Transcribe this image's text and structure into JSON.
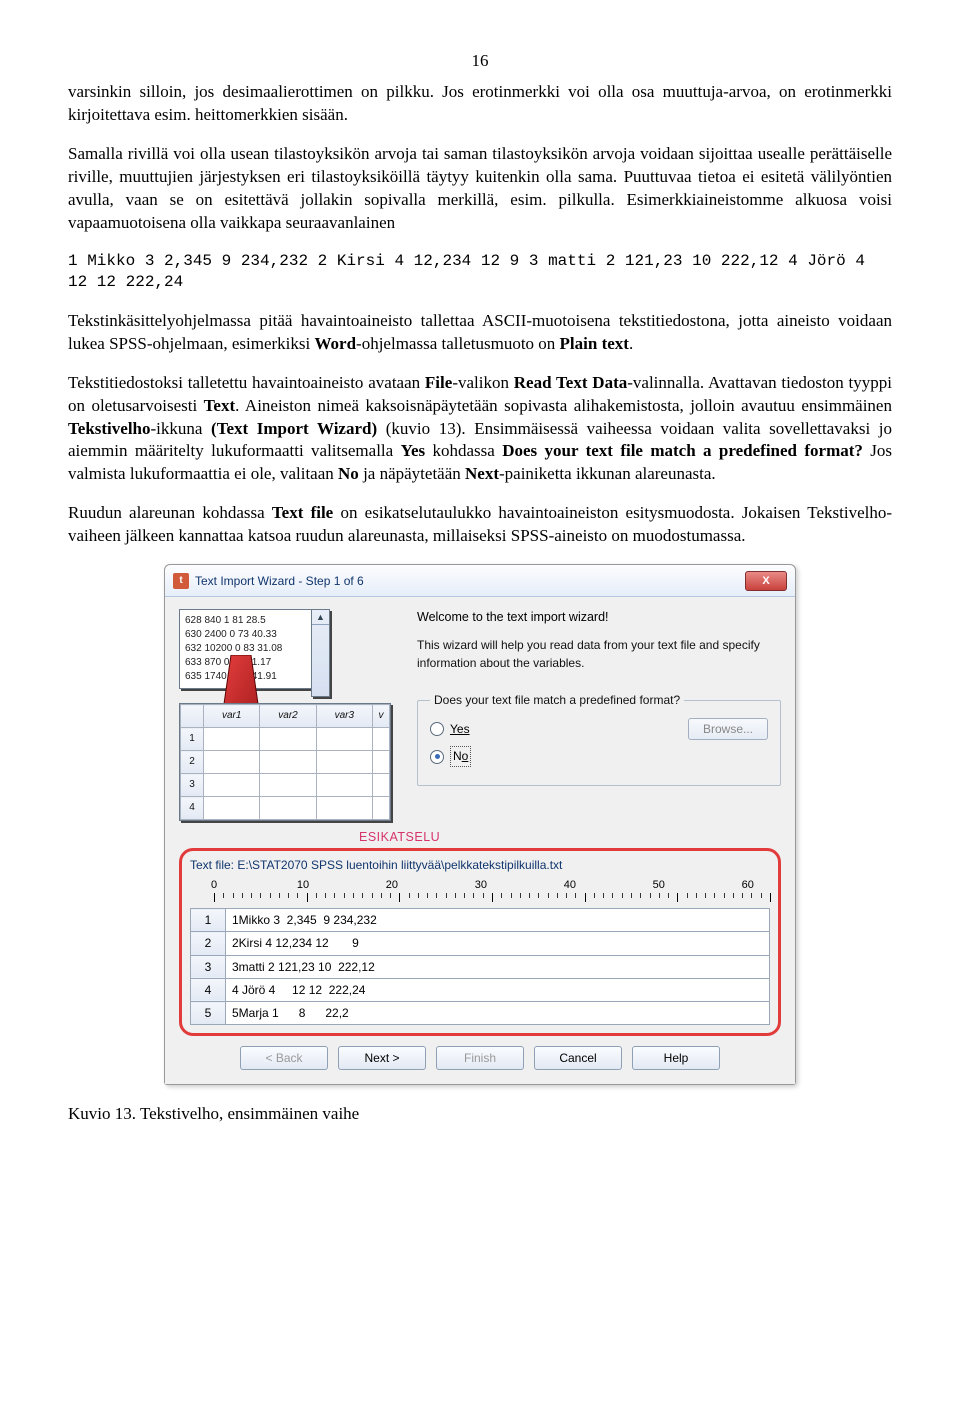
{
  "page_number": "16",
  "para1_a": "varsinkin silloin, jos desimaalierottimen on pilkku. Jos erotinmerkki voi olla osa muuttuja-arvoa, on erotinmerkki kirjoitettava esim. heittomerkkien sisään.",
  "para1_b": "Samalla rivillä voi olla usean tilastoyksikön arvoja tai saman tilastoyksikön arvoja voidaan sijoittaa usealle perättäiselle riville, muuttujien järjestyksen eri tilastoyksiköillä täytyy kuitenkin olla sama. Puuttuvaa tietoa ei esitetä välilyöntien avulla, vaan se on esitettävä jollakin sopivalla merkillä, esim. pilkulla. Esimerkkiaineistomme alkuosa voisi vapaamuotoisena olla vaikkapa seuraavanlainen",
  "monoblock": "1 Mikko 3 2,345 9 234,232 2 Kirsi 4 12,234 12 9 3 matti 2 121,23 10 222,12 4 Jörö 4 12 12 222,24",
  "para2_a": "Tekstinkäsittelyohjelmassa pitää havaintoaineisto tallettaa ASCII-muotoisena tekstitiedostona, jotta aineisto voidaan lukea SPSS-ohjelmaan, esimerkiksi ",
  "para2_b": "Word",
  "para2_c": "-ohjelmassa talletusmuoto on ",
  "para2_d": "Plain text",
  "para2_e": ".",
  "para3_a": "Tekstitiedostoksi talletettu havaintoaineisto avataan ",
  "para3_b": "File",
  "para3_c": "-valikon ",
  "para3_d": "Read Text Data",
  "para3_e": "-valinnalla. Avattavan tiedoston tyyppi on oletusarvoisesti ",
  "para3_f": "Text",
  "para3_g": ". Aineiston nimeä kaksoisnäpäytetään sopivasta alihakemistosta, jolloin avautuu ensimmäinen ",
  "para3_h": "Tekstivelho",
  "para3_i": "-ikkuna ",
  "para3_j": "(Text Import Wizard)",
  "para3_k": " (kuvio 13). Ensimmäisessä vaiheessa voidaan valita sovellettavaksi jo aiemmin määritelty lukuformaatti valitsemalla ",
  "para3_l": "Yes",
  "para3_m": " kohdassa ",
  "para3_n": "Does your text file match a predefined format?",
  "para3_o": "  Jos valmista lukuformaattia ei ole, valitaan ",
  "para3_p": "No",
  "para3_q": " ja näpäytetään ",
  "para3_r": "Next",
  "para3_s": "-painiketta ikkunan alareunasta.",
  "para4_a": "Ruudun alareunan kohdassa ",
  "para4_b": "Text file",
  "para4_c": " on esikatselutaulukko havaintoaineiston esitysmuodosta. Jokaisen Tekstivelho-vaiheen jälkeen kannattaa katsoa ruudun alareunasta, millaiseksi SPSS-aineisto on muodostumassa.",
  "caption": "Kuvio 13. Tekstivelho, ensimmäinen vaihe",
  "dialog": {
    "title": "Text Import Wizard - Step 1 of 6",
    "close": "X",
    "welcome": "Welcome to the text import wizard!",
    "desc": "This wizard will help you read data from your text file and specify information about the variables.",
    "match_legend": "Does your text file match a predefined format?",
    "yes": "Yes",
    "no": "No",
    "browse": "Browse...",
    "esikatselu": "ESIKATSELU",
    "textfile_label": "Text file:  E:\\STAT2070 SPSS luentoihin liittyvää\\pelkkatekstipilkuilla.txt",
    "numbox": [
      "628 840 1 81 28.5",
      "630 2400 0 73 40.33",
      "632 10200 0 83 31.08",
      "633 870 0 93 31.17",
      "635 1740 0 83 41.91"
    ],
    "gridcols": [
      "",
      "var1",
      "var2",
      "var3",
      "v"
    ],
    "gridrows": [
      "1",
      "2",
      "3",
      "4"
    ],
    "ruler": [
      "0",
      "10",
      "20",
      "30",
      "40",
      "50",
      "60"
    ],
    "preview": [
      "1Mikko 3  2,345  9 234,232",
      "2Kirsi 4 12,234 12       9",
      "3matti 2 121,23 10  222,12",
      "4 Jörö 4     12 12  222,24",
      "5Marja 1      8      22,2"
    ],
    "buttons": {
      "back": "< Back",
      "next": "Next >",
      "finish": "Finish",
      "cancel": "Cancel",
      "help": "Help"
    }
  }
}
